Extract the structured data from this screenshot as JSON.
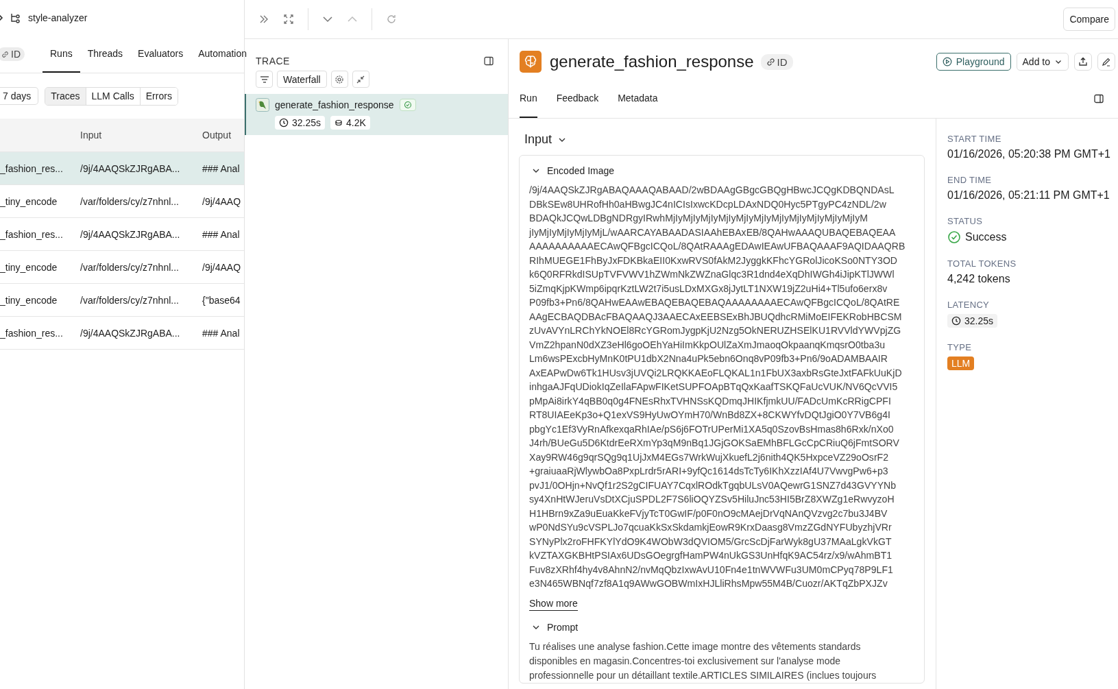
{
  "breadcrumb": {
    "project": "style-analyzer"
  },
  "runs_panel": {
    "id_badge": "ID",
    "tabs": [
      {
        "label": "Runs",
        "selected": true
      },
      {
        "label": "Threads",
        "selected": false
      },
      {
        "label": "Evaluators",
        "selected": false
      },
      {
        "label": "Automation",
        "selected": false
      }
    ],
    "date_filter": "7 days",
    "view_toggle": [
      {
        "label": "Traces",
        "selected": true
      },
      {
        "label": "LLM Calls",
        "selected": false
      },
      {
        "label": "Errors",
        "selected": false
      }
    ],
    "table": {
      "columns": [
        "Input",
        "Output"
      ],
      "rows": [
        {
          "name": "_fashion_res...",
          "input": "/9j/4AAQSkZJRgABA...",
          "output": "### Anal",
          "selected": true
        },
        {
          "name": "_tiny_encode",
          "input": "/var/folders/cy/z7nhnl...",
          "output": "/9j/4AAQ",
          "selected": false
        },
        {
          "name": "_fashion_res...",
          "input": "/9j/4AAQSkZJRgABA...",
          "output": "### Anal",
          "selected": false
        },
        {
          "name": "_tiny_encode",
          "input": "/var/folders/cy/z7nhnl...",
          "output": "/9j/4AAQ",
          "selected": false
        },
        {
          "name": "_tiny_encode",
          "input": "/var/folders/cy/z7nhnl...",
          "output": "{\"base64",
          "selected": false
        },
        {
          "name": "_fashion_res...",
          "input": "/9j/4AAQSkZJRgABA...",
          "output": "### Anal",
          "selected": false
        }
      ]
    }
  },
  "toolbar": {
    "compare": "Compare"
  },
  "trace": {
    "title": "TRACE",
    "view": "Waterfall",
    "node": {
      "name": "generate_fashion_response",
      "succeeded": true,
      "latency": "32.25s",
      "tokens": "4.2K",
      "selected": true
    }
  },
  "run": {
    "name": "generate_fashion_response",
    "id_badge": "ID",
    "playground": "Playground",
    "add_to": "Add to",
    "tabs": [
      {
        "label": "Run",
        "selected": true
      },
      {
        "label": "Feedback",
        "selected": false
      },
      {
        "label": "Metadata",
        "selected": false
      }
    ],
    "input_title": "Input",
    "sections": [
      {
        "kind": "code",
        "title": "Encoded Image",
        "expanded": true,
        "show_more": "Show more",
        "lines": [
          "/9j/4AAQSkZJRgABAQAAAQABAAD/2wBDAAgGBgcGBQgHBwcJCQgKDBQNDAsL",
          "DBkSEw8UHRofHh0aHBwgJC4nICIsIxwcKDcpLDAxNDQ0Hyc5PTgyPC4zNDL/2w",
          "BDAQkJCQwLDBgNDRgyIRwhMjIyMjIyMjIyMjIyMjIyMjIyMjIyMjIyMjIyMjIyMjIyM",
          "jIyMjIyMjIyMjIyMjL/wAARCAYABAADASIAAhEBAxEB/8QAHwAAAQUBAQEBAQEAA",
          "AAAAAAAAAAECAwQFBgcICQoL/8QAtRAAAgEDAwIEAwUFBAQAAAF9AQIDAAQRB",
          "RIhMUEGE1FhByJxFDKBkaEII0KxwRVS0fAkM2JyggkKFhcYGRolJicoKSo0NTY3OD",
          "k6Q0RFRkdISUpTVFVWV1hZWmNkZWZnaGlqc3R1dnd4eXqDhIWGh4iJipKTlJWWl",
          "5iZmqKjpKWmp6ipqrKztLW2t7i5usLDxMXGx8jJytLT1NXW19jZ2uHi4+Tl5ufo6erx8v",
          "P09fb3+Pn6/8QAHwEAAwEBAQEBAQEBAQAAAAAAAAECAwQFBgcICQoL/8QAtRE",
          "AAgECBAQDBAcFBAQAAQJ3AAECAxEEBSExBhJBUQdhcRMiMoEIFEKRobHBCSM",
          "zUvAVYnLRChYkNOEl8RcYGRomJygpKjU2Nzg5OkNERUZHSElKU1RVVldYWVpjZG",
          "VmZ2hpanN0dXZ3eHl6goOEhYaHiImKkpOUlZaXmJmaoqOkpaanqKmqsrO0tba3u",
          "Lm6wsPExcbHyMnK0tPU1dbX2Nna4uPk5ebn6Onq8vP09fb3+Pn6/9oADAMBAAIR",
          "AxEAPwDw6Tk1HUsv3jUVQi2LRQKKAEoFLQKAL1n1FbUX3axbRsGteJxtFAFkUuKjD",
          "inhgaAJFqUDiokIqZeIlaFApwFIKetSUPFOApBTqQxKaafTSKQFaUcVUK/NV6QcVVI5",
          "pMpAi8irkY4qBB0q0g4FNEsRhxTVHNSsKQDmqJHIKfjmkUU/FADcUmKcRRigCPFI",
          "RT8UIAEeKp3o+Q1exVS9HyUwOYmH70/WnBd8ZX+8CKWYfvDQtJgiO0Y7VB6g4I",
          "pbgYc1Ef3VyRnAfkexqaRhIAe/pS6j6FOTrUPerMi1XA5q0SzovBsHmas8h6Rxk/nXo0",
          "J4rh/BUeGu5D6KtdrEeRXmYp3qM9nBq1JGjGOKSaEMhBFLGcCpCRiuQ6jFmtSORV",
          "Xay9RW46g9qrSQg9q1UjJxM4EGs7WrkWujXkuefL2j6nith4QK5HxpceVZ29oOsrF2",
          "+graiuaaRjWlywbOa8PxpLrdr5rARI+9yfQc1614dsTcTy6IKhXzzIAf4U7VwvgPw6+p3",
          "pvJ1/0OHjn+NvQf1r2S2gCIFUAY7CqxlROdkTgqbULsV0AQewrG1SNZ7d43GVYYNb",
          "sy4XnHtWJeruVsDtXCjuSPDL2F7S6liOQYZSv5HiluJnc53HI5BrZ8XWZg1eRwvyzoH",
          "H1HBrn9xZa9uEuaKkeFVjyTcT0GwIF/p0F0nO9cMAejDrVqNAnQVzvg2c7bu3J4BV",
          "wP0NdSYu9cVSPLJo7qcuaKkSxSkdamkjEowR9KrxDaasg8VmzZGdNYFUbyzhjVRr",
          "SYNyPlx2roFHFKYlYdO9K4WObW3dQVIOM5/GrcScDjFarWyk8gU37MAaLgkVkGT",
          "kVZTAXGKBHtPSIAx6UDsGOegrgfHamPW4nUkGS3UnHfqK9AC54rz/x9/wAhmBT1",
          "Fuv8zXRhf4hy4v8AhnN2/nvMqQbzIxwAvU10Fn4e1tnWVWFu3UM0mCPyq78P9LF1",
          "e3N465WBNqf7zf8A1q9AWwGOBWmIxHJLliRhsMpw55M4B/Cuozr/AKTqZbPXJZv"
        ]
      },
      {
        "kind": "text",
        "title": "Prompt",
        "expanded": true,
        "text": "Tu réalises une analyse fashion.Cette image montre des vêtements standards disponibles en magasin.Concentres-toi exclusivement sur l'analyse mode professionnelle pour un détaillant textile.ARTICLES SIMILAIRES (inclues toujours"
      }
    ]
  },
  "details": [
    {
      "kind": "text",
      "label": "START TIME",
      "value": "01/16/2026, 05:20:38 PM GMT+1"
    },
    {
      "kind": "text",
      "label": "END TIME",
      "value": "01/16/2026, 05:21:11 PM GMT+1"
    },
    {
      "kind": "status",
      "label": "STATUS",
      "value": "Success",
      "succeeded": true
    },
    {
      "kind": "text",
      "label": "TOTAL TOKENS",
      "value": "4,242 tokens"
    },
    {
      "kind": "latency",
      "label": "LATENCY",
      "value": "32.25s"
    },
    {
      "kind": "badge",
      "label": "TYPE",
      "value": "LLM"
    }
  ]
}
